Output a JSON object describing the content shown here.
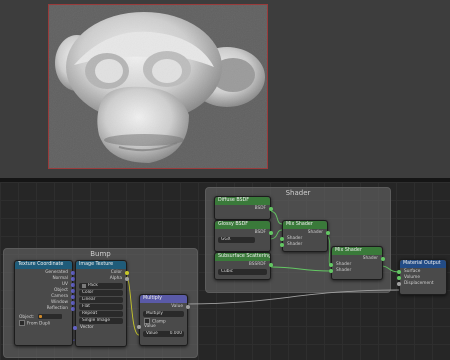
{
  "frames": {
    "shader_label": "Shader",
    "bump_label": "Bump"
  },
  "nodes": {
    "texcoord": {
      "title": "Texture Coordinate",
      "outputs": [
        "Generated",
        "Normal",
        "UV",
        "Object",
        "Camera",
        "Window",
        "Reflection"
      ],
      "object_label": "Object:",
      "from_dupli": "From Dupli"
    },
    "image_texture": {
      "title": "Image Texture",
      "outputs": [
        "Color",
        "Alpha"
      ],
      "image_name": "Pack",
      "options": [
        "Color",
        "Linear",
        "Flat",
        "Repeat",
        "Single Image"
      ],
      "input": "Vector"
    },
    "multiply": {
      "title": "Multiply",
      "output": "Value",
      "operation": "Multiply",
      "clamp": "Clamp",
      "input_value": "Value",
      "value_field": "Value",
      "value_number": "0.000"
    },
    "diffuse": {
      "title": "Diffuse BSDF",
      "output": "BSDF"
    },
    "glossy": {
      "title": "Glossy BSDF",
      "output": "BSDF",
      "distribution": "GGX"
    },
    "sss": {
      "title": "Subsurface Scattering",
      "output": "BSSRDF",
      "falloff": "Cubic"
    },
    "mix1": {
      "title": "Mix Shader",
      "output": "Shader",
      "inputs": [
        "Shader",
        "Shader"
      ]
    },
    "mix2": {
      "title": "Mix Shader",
      "output": "Shader",
      "inputs": [
        "Shader",
        "Shader"
      ]
    },
    "output": {
      "title": "Material Output",
      "inputs": [
        "Surface",
        "Volume",
        "Displacement"
      ]
    }
  },
  "colors": {
    "texture_header": "#1f5c7a",
    "shader_header": "#3a7a3a",
    "converter_header": "#5a5aa8",
    "output_header": "#234c86",
    "render_border": "#9a3b3b"
  }
}
